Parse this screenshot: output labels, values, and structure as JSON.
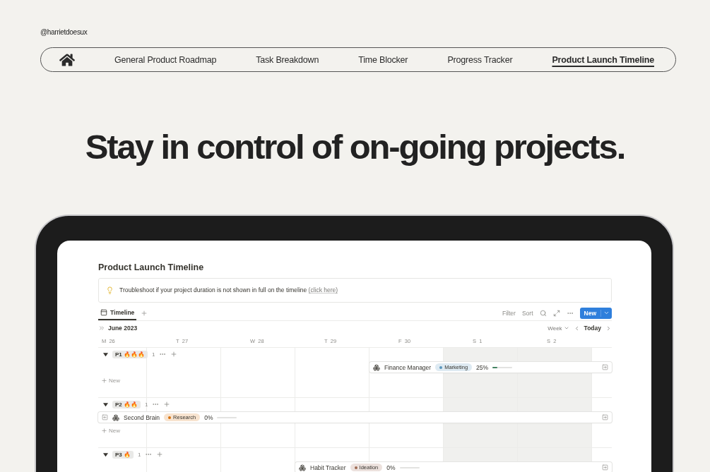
{
  "handle": "@harrietdoesux",
  "nav": {
    "items": [
      {
        "label": "General Product Roadmap",
        "selected": false
      },
      {
        "label": "Task Breakdown",
        "selected": false
      },
      {
        "label": "Time Blocker",
        "selected": false
      },
      {
        "label": "Progress Tracker",
        "selected": false
      },
      {
        "label": "Product Launch Timeline",
        "selected": true
      }
    ]
  },
  "headline": "Stay in control of on-going projects.",
  "app": {
    "title": "Product Launch Timeline",
    "callout": {
      "text": "Troubleshoot if your project duration is not shown in full on the timeline",
      "link": "(click here)"
    },
    "views": [
      {
        "label": "Timeline",
        "selected": true
      }
    ],
    "toolbar": {
      "filter": "Filter",
      "sort": "Sort",
      "new": "New"
    },
    "month": "June 2023",
    "scale": "Week",
    "today": "Today",
    "days": [
      {
        "letter": "M",
        "date": "26",
        "weekend": false
      },
      {
        "letter": "T",
        "date": "27",
        "weekend": false
      },
      {
        "letter": "W",
        "date": "28",
        "weekend": false
      },
      {
        "letter": "T",
        "date": "29",
        "weekend": false
      },
      {
        "letter": "F",
        "date": "30",
        "weekend": false
      },
      {
        "letter": "S",
        "date": "1",
        "weekend": true
      },
      {
        "letter": "S",
        "date": "2",
        "weekend": true
      }
    ],
    "groups": [
      {
        "label": "P1",
        "flames": "🔥🔥🔥",
        "count": "1",
        "expanded": true,
        "item": {
          "name": "Finance Manager",
          "starts_before": false,
          "tag": {
            "label": "Marketing",
            "color": "#5b97bd"
          },
          "progress": "25%",
          "level": 0.25
        },
        "new": "New"
      },
      {
        "label": "P2",
        "flames": "🔥🔥",
        "count": "1",
        "expanded": true,
        "item": {
          "name": "Second Brain",
          "starts_before": true,
          "tag": {
            "label": "Research",
            "color": "#d9730d"
          },
          "progress": "0%",
          "level": 0
        },
        "new": "New"
      },
      {
        "label": "P3",
        "flames": "🔥",
        "count": "1",
        "expanded": true,
        "item": {
          "name": "Habit Tracker",
          "starts_before": false,
          "tag": {
            "label": "Ideation",
            "color": "#9f6b53"
          },
          "progress": "0%",
          "level": 0
        }
      }
    ]
  }
}
